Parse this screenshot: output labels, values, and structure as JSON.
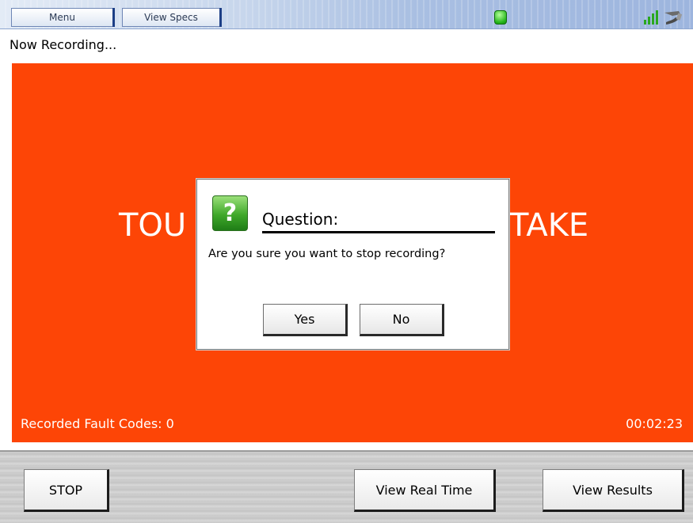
{
  "topbar": {
    "menu_label": "Menu",
    "view_specs_label": "View Specs",
    "status_color": "#25b51a",
    "icons": [
      "status-led-icon",
      "signal-strength-icon",
      "plug-connection-icon"
    ]
  },
  "recording_label": "Now Recording...",
  "panel": {
    "background_color": "#fd4506",
    "touch_text_left": "TOU",
    "touch_text_right": "TAKE",
    "fault_codes": "Recorded Fault Codes: 0",
    "timer": "00:02:23"
  },
  "dialog": {
    "icon_glyph": "?",
    "title": "Question:",
    "message": "Are you sure you want to stop recording?",
    "yes_label": "Yes",
    "no_label": "No"
  },
  "bottombar": {
    "stop_label": "STOP",
    "view_real_time_label": "View Real Time",
    "view_results_label": "View Results"
  }
}
